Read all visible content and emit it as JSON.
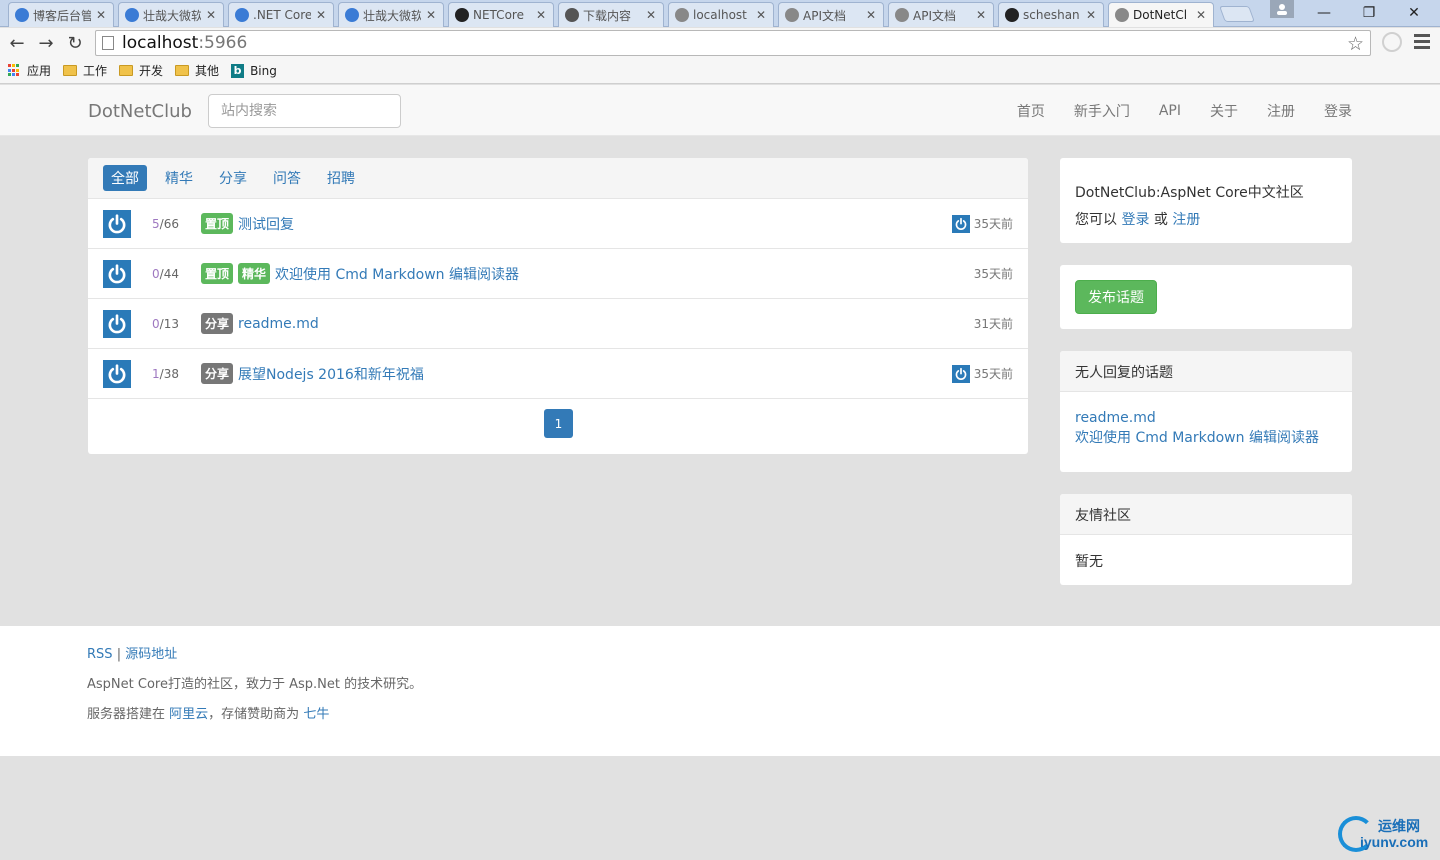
{
  "browser": {
    "tabs": [
      {
        "title": "博客后台管",
        "icon": "tab-site-icon",
        "color": "#3a7bd5"
      },
      {
        "title": "壮哉大微软",
        "icon": "tab-site-icon",
        "color": "#3a7bd5"
      },
      {
        "title": ".NET Core",
        "icon": "tab-site-icon",
        "color": "#3a7bd5"
      },
      {
        "title": "壮哉大微软",
        "icon": "tab-site-icon",
        "color": "#3a7bd5"
      },
      {
        "title": "NETCore",
        "icon": "github-icon",
        "color": "#222222"
      },
      {
        "title": "下载内容",
        "icon": "download-icon",
        "color": "#555555"
      },
      {
        "title": "localhost",
        "icon": "page-icon",
        "color": "#888888"
      },
      {
        "title": "API文档",
        "icon": "page-icon",
        "color": "#888888"
      },
      {
        "title": "API文档",
        "icon": "page-icon",
        "color": "#888888"
      },
      {
        "title": "scheshan",
        "icon": "github-icon",
        "color": "#222222"
      },
      {
        "title": "DotNetCl",
        "icon": "page-icon",
        "color": "#888888",
        "active": true
      }
    ],
    "url_host": "localhost",
    "url_port": ":5966",
    "bookmarks": [
      {
        "label": "应用",
        "icon": "apps-icon"
      },
      {
        "label": "工作",
        "icon": "folder-icon"
      },
      {
        "label": "开发",
        "icon": "folder-icon"
      },
      {
        "label": "其他",
        "icon": "folder-icon"
      },
      {
        "label": "Bing",
        "icon": "bing-icon"
      }
    ]
  },
  "navbar": {
    "brand": "DotNetClub",
    "search_placeholder": "站内搜索",
    "links": [
      "首页",
      "新手入门",
      "API",
      "关于",
      "注册",
      "登录"
    ]
  },
  "topics": {
    "tabs": [
      "全部",
      "精华",
      "分享",
      "问答",
      "招聘"
    ],
    "active_tab": 0,
    "rows": [
      {
        "replies": "5",
        "views": "66",
        "badges": [
          {
            "text": "置顶",
            "color": "#5cb85c"
          }
        ],
        "title": "测试回复",
        "time": "35天前",
        "last_reply_avatar": true
      },
      {
        "replies": "0",
        "views": "44",
        "badges": [
          {
            "text": "置顶",
            "color": "#5cb85c"
          },
          {
            "text": "精华",
            "color": "#5cb85c"
          }
        ],
        "title": "欢迎使用 Cmd Markdown 编辑阅读器",
        "time": "35天前",
        "last_reply_avatar": false
      },
      {
        "replies": "0",
        "views": "13",
        "badges": [
          {
            "text": "分享",
            "color": "#777777"
          }
        ],
        "title": "readme.md",
        "time": "31天前",
        "last_reply_avatar": false
      },
      {
        "replies": "1",
        "views": "38",
        "badges": [
          {
            "text": "分享",
            "color": "#777777"
          }
        ],
        "title": "展望Nodejs 2016和新年祝福",
        "time": "35天前",
        "last_reply_avatar": true
      }
    ],
    "page": "1"
  },
  "sidebar": {
    "intro_title": "DotNetClub:AspNet Core中文社区",
    "intro_prefix": "您可以",
    "intro_login": "登录",
    "intro_or": "或",
    "intro_register": "注册",
    "publish_label": "发布话题",
    "no_reply_header": "无人回复的话题",
    "no_reply_items": [
      "readme.md",
      "欢迎使用 Cmd Markdown 编辑阅读器"
    ],
    "friends_header": "友情社区",
    "friends_empty": "暂无"
  },
  "footer": {
    "rss": "RSS",
    "sep": "|",
    "source": "源码地址",
    "line2": "AspNet Core打造的社区，致力于 Asp.Net 的技术研究。",
    "line3_prefix": "服务器搭建在",
    "line3_host": "阿里云",
    "line3_mid": "，存储赞助商为",
    "line3_sponsor": "七牛"
  },
  "watermark": {
    "cn": "运维网",
    "en": "iyunv.com"
  },
  "colors": {
    "link": "#337ab7",
    "success": "#5cb85c",
    "badge_gray": "#777777",
    "avatar": "#2a7ab8"
  }
}
